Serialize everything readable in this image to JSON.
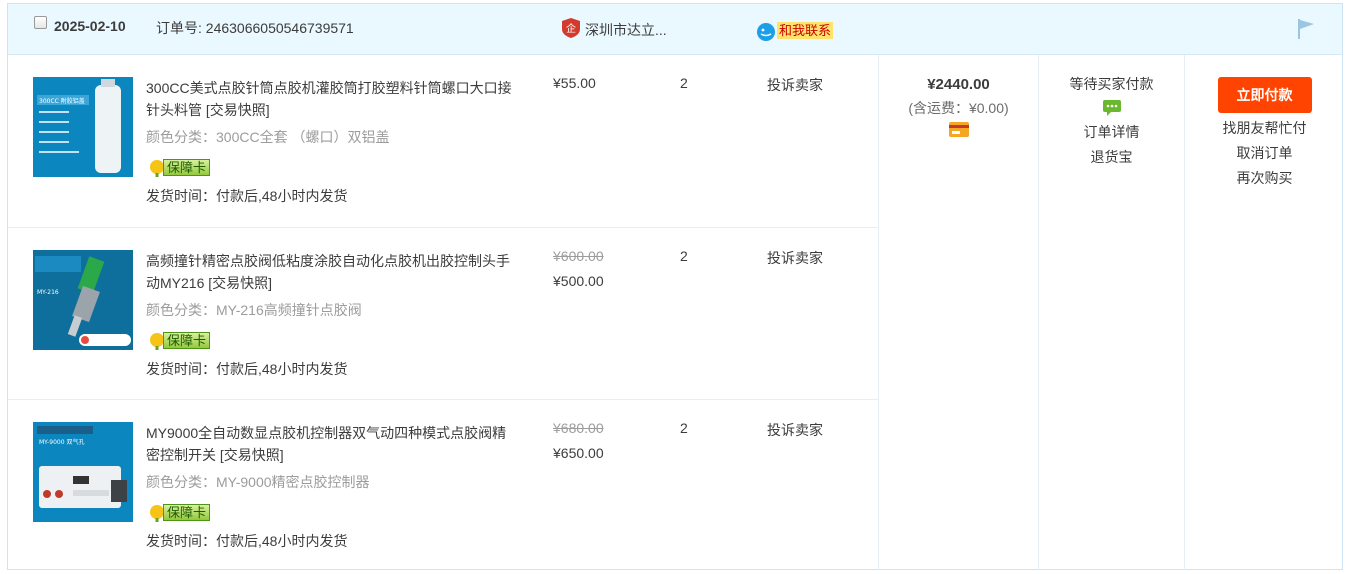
{
  "order": {
    "date": "2025-02-10",
    "order_no_label": "订单号:",
    "order_no": "2463066050546739571",
    "shop_name": "深圳市达立...",
    "contact_label": "和我联系"
  },
  "items": [
    {
      "title": "300CC美式点胶针筒点胶机灌胶筒打胶塑料针筒螺口大口接针头料管",
      "snapshot": "[交易快照]",
      "sku": "颜色分类：300CC全套 （螺口）双铝盖",
      "badge": "保障卡",
      "ship_time": "发货时间：付款后,48小时内发货",
      "old_price": "",
      "price": "¥55.00",
      "qty": "2",
      "complain": "投诉卖家",
      "thumb_label": "300CC 附胶铝盖"
    },
    {
      "title": "高频撞针精密点胶阀低粘度涂胶自动化点胶机出胶控制头手动MY216",
      "snapshot": "[交易快照]",
      "sku": "颜色分类：MY-216高频撞针点胶阀",
      "badge": "保障卡",
      "ship_time": "发货时间：付款后,48小时内发货",
      "old_price": "¥600.00",
      "price": "¥500.00",
      "qty": "2",
      "complain": "投诉卖家",
      "thumb_label": "MY-216"
    },
    {
      "title": "MY9000全自动数显点胶机控制器双气动四种模式点胶阀精密控制开关",
      "snapshot": "[交易快照]",
      "sku": "颜色分类：MY-9000精密点胶控制器",
      "badge": "保障卡",
      "ship_time": "发货时间：付款后,48小时内发货",
      "old_price": "¥680.00",
      "price": "¥650.00",
      "qty": "2",
      "complain": "投诉卖家",
      "thumb_label": "MY-9000 双气孔"
    }
  ],
  "summary": {
    "total": "¥2440.00",
    "shipping": "(含运费：¥0.00)"
  },
  "status": {
    "state": "等待买家付款",
    "detail": "订单详情",
    "refund": "退货宝"
  },
  "actions": {
    "pay": "立即付款",
    "friend_pay": "找朋友帮忙付",
    "cancel": "取消订单",
    "rebuy": "再次购买"
  },
  "colors": {
    "header_bg": "#eaf8ff",
    "pay_button": "#ff4401",
    "thumb_bg": "#0b86bf"
  },
  "icons": [
    "checkbox-icon",
    "shop-icon",
    "wangwang-icon",
    "flag-icon",
    "shield-icon",
    "card-icon",
    "message-icon"
  ]
}
